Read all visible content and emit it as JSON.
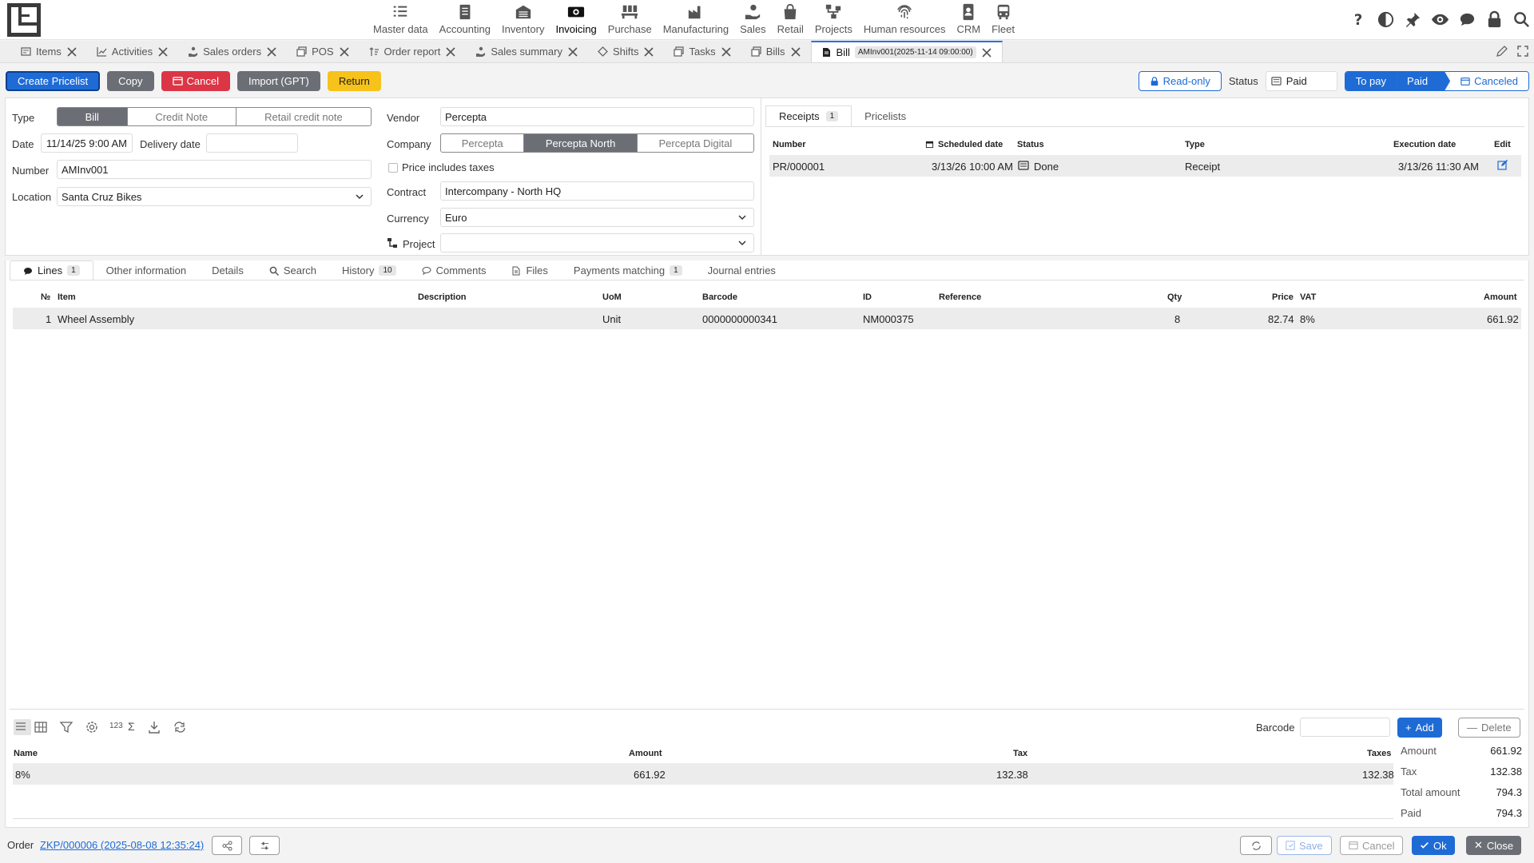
{
  "modules": [
    {
      "label": "Master data",
      "icon": "checklist-icon"
    },
    {
      "label": "Accounting",
      "icon": "ledger-icon"
    },
    {
      "label": "Inventory",
      "icon": "warehouse-icon"
    },
    {
      "label": "Invoicing",
      "icon": "cash-icon"
    },
    {
      "label": "Purchase",
      "icon": "pallet-icon"
    },
    {
      "label": "Manufacturing",
      "icon": "factory-icon"
    },
    {
      "label": "Sales",
      "icon": "sales-hand-icon"
    },
    {
      "label": "Retail",
      "icon": "shopping-bag-icon"
    },
    {
      "label": "Projects",
      "icon": "project-tree-icon"
    },
    {
      "label": "Human resources",
      "icon": "fingerprint-icon"
    },
    {
      "label": "CRM",
      "icon": "contact-card-icon"
    },
    {
      "label": "Fleet",
      "icon": "bus-icon"
    }
  ],
  "active_module": "Invoicing",
  "tabs": [
    {
      "label": "Items",
      "icon": "items-icon"
    },
    {
      "label": "Activities",
      "icon": "chart-icon"
    },
    {
      "label": "Sales orders",
      "icon": "sales-hand-icon"
    },
    {
      "label": "POS",
      "icon": "pos-icon"
    },
    {
      "label": "Order report",
      "icon": "sort-icon"
    },
    {
      "label": "Sales summary",
      "icon": "sales-hand-icon"
    },
    {
      "label": "Shifts",
      "icon": "shift-icon"
    },
    {
      "label": "Tasks",
      "icon": "tasks-icon"
    },
    {
      "label": "Bills",
      "icon": "bills-icon"
    }
  ],
  "active_tab": {
    "label": "Bill",
    "badge": "AMInv001(2025-11-14 09:00:00)"
  },
  "toolbar": {
    "create_pricelist": "Create Pricelist",
    "copy": "Copy",
    "cancel": "Cancel",
    "import": "Import (GPT)",
    "return": "Return"
  },
  "header_right": {
    "readonly": "Read-only",
    "status_label": "Status",
    "status_value": "Paid",
    "flow": [
      "To pay",
      "Paid",
      "Canceled"
    ]
  },
  "form": {
    "type_label": "Type",
    "type_options": [
      "Bill",
      "Credit Note",
      "Retail credit note"
    ],
    "type_selected": "Bill",
    "date_label": "Date",
    "date_value": "11/14/25 9:00 AM",
    "delivery_label": "Delivery date",
    "delivery_value": "",
    "number_label": "Number",
    "number_value": "AMInv001",
    "location_label": "Location",
    "location_value": "Santa Cruz Bikes",
    "vendor_label": "Vendor",
    "vendor_value": "Percepta",
    "company_label": "Company",
    "company_options": [
      "Percepta",
      "Percepta North",
      "Percepta Digital"
    ],
    "company_selected": "Percepta North",
    "price_taxes_label": "Price includes taxes",
    "contract_label": "Contract",
    "contract_value": "Intercompany - North HQ",
    "currency_label": "Currency",
    "currency_value": "Euro",
    "project_label": "Project",
    "project_value": ""
  },
  "receipts": {
    "tab_receipts": "Receipts",
    "tab_receipts_count": "1",
    "tab_pricelists": "Pricelists",
    "headers": [
      "Number",
      "Scheduled date",
      "Status",
      "Type",
      "Execution date",
      "Edit"
    ],
    "rows": [
      {
        "number": "PR/000001",
        "scheduled": "3/13/26 10:00 AM",
        "status": "Done",
        "type": "Receipt",
        "execution": "3/13/26 11:30 AM"
      }
    ]
  },
  "lines_tabs": [
    {
      "label": "Lines",
      "count": "1"
    },
    {
      "label": "Other information"
    },
    {
      "label": "Details"
    },
    {
      "label": "Search"
    },
    {
      "label": "History",
      "count": "10"
    },
    {
      "label": "Comments"
    },
    {
      "label": "Files"
    },
    {
      "label": "Payments matching",
      "count": "1"
    },
    {
      "label": "Journal entries"
    }
  ],
  "lines": {
    "headers": [
      "№",
      "Item",
      "Description",
      "UoM",
      "Barcode",
      "ID",
      "Reference",
      "Qty",
      "Price",
      "VAT",
      "Amount"
    ],
    "rows": [
      {
        "no": "1",
        "item": "Wheel Assembly",
        "description": "",
        "uom": "Unit",
        "barcode": "0000000000341",
        "id": "NM000375",
        "reference": "",
        "qty": "8",
        "price": "82.74",
        "vat": "8%",
        "amount": "661.92"
      }
    ]
  },
  "bottom": {
    "num_toggle": "123",
    "sigma": "Σ",
    "barcode_label": "Barcode",
    "add": "Add",
    "delete": "Delete",
    "tax_headers": [
      "Name",
      "Amount",
      "Tax",
      "Taxes"
    ],
    "tax_rows": [
      {
        "name": "8%",
        "amount": "661.92",
        "tax": "132.38",
        "taxes": "132.38"
      }
    ],
    "summary": [
      {
        "label": "Amount",
        "value": "661.92"
      },
      {
        "label": "Tax",
        "value": "132.38"
      },
      {
        "label": "Total amount",
        "value": "794.3"
      },
      {
        "label": "Paid",
        "value": "794.3"
      }
    ]
  },
  "footer": {
    "order_label": "Order",
    "order_link": "ZKP/000006 (2025-08-08 12:35:24)",
    "save": "Save",
    "cancel": "Cancel",
    "ok": "Ok",
    "close": "Close"
  },
  "colors": {
    "primary": "#1e6bd6",
    "danger": "#dc3545",
    "warning": "#f7c21a",
    "neutral": "#6b6f75"
  }
}
